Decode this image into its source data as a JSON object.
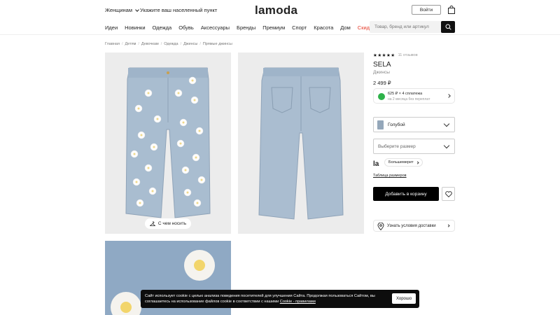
{
  "header": {
    "gender": "Женщинам",
    "location": "Укажите ваш населенный пункт",
    "logo": "lamoda",
    "login": "Войти"
  },
  "nav": {
    "items": [
      {
        "label": "Идеи"
      },
      {
        "label": "Новинки"
      },
      {
        "label": "Одежда"
      },
      {
        "label": "Обувь"
      },
      {
        "label": "Аксессуары"
      },
      {
        "label": "Бренды"
      },
      {
        "label": "Премиум"
      },
      {
        "label": "Спорт"
      },
      {
        "label": "Красота"
      },
      {
        "label": "Дом"
      },
      {
        "label": "Скидки"
      }
    ],
    "search_placeholder": "Товар, бренд или артикул"
  },
  "breadcrumb": [
    "Главная",
    "Детям",
    "Девочкам",
    "Одежда",
    "Джинсы",
    "Прямые джинсы"
  ],
  "gallery": {
    "wear_label": "С чем носить"
  },
  "product": {
    "stars": "★★★★★",
    "reviews": "11 отзывов",
    "brand": "SELA",
    "type": "Джинсы",
    "price": "2 499 ₽",
    "split_line1": "625 ₽ × 4 сплатежа",
    "split_line2": "на 2 месяца без переплат",
    "color": "Голубой",
    "size_placeholder": "Выберите размер",
    "la_mark": "la",
    "fit_badge": "Большемерит",
    "size_table": "Таблица размеров",
    "add_to_cart": "Добавить в корзину",
    "delivery": "Узнать условия доставки",
    "swatch_color": "#94a7ba"
  },
  "cookie": {
    "text": "Сайт использует cookie с целью анализа поведения посетителей для улучшения Сайта. Продолжая пользоваться Сайтом, вы соглашаетесь на использование файлов cookie в соответствии с нашими ",
    "link": "Cookie - правилами",
    "button": "Хорошо"
  },
  "colors": {
    "accent_sale": "#e53c2b",
    "split_green": "#2eb24a",
    "denim": "#8fa9c4"
  }
}
